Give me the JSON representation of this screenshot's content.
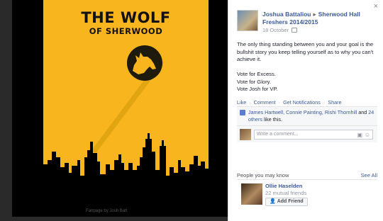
{
  "poster": {
    "title": "THE WOLF",
    "subtitle": "OF SHERWOOD",
    "caption": "Fanpage by Josh Batt"
  },
  "post": {
    "author": "Joshua Battaliou",
    "arrow": "▸",
    "group": "Sherwood Hall Freshers 2014/2015",
    "date": "18 October",
    "body": "The only thing standing between you and your goal is the bullshit story you keep telling yourself as to why you can't achieve it.\n\nVote for Excess.\nVote for Glory.\nVote Josh for VP."
  },
  "actions": {
    "like": "Like",
    "comment": "Comment",
    "notifications": "Get Notifications",
    "share": "Share",
    "sep": "·"
  },
  "likes": {
    "names": "James Hartwell, Connie Painting, Rishi Thornhill",
    "and": " and ",
    "others": "24 others",
    "suffix": " like this."
  },
  "comment": {
    "placeholder": "Write a comment..."
  },
  "pymk": {
    "heading": "People you may know",
    "see_all": "See All",
    "person_name": "Ollie Haselden",
    "mutual": "22 mutual friends",
    "add_friend": "Add Friend"
  },
  "close": "×",
  "icons": {
    "camera": "camera-icon",
    "smile": "smile-icon",
    "like": "like-icon",
    "close": "close-icon"
  },
  "colors": {
    "poster_bg": "#f8b51e",
    "link": "#3b5998"
  }
}
